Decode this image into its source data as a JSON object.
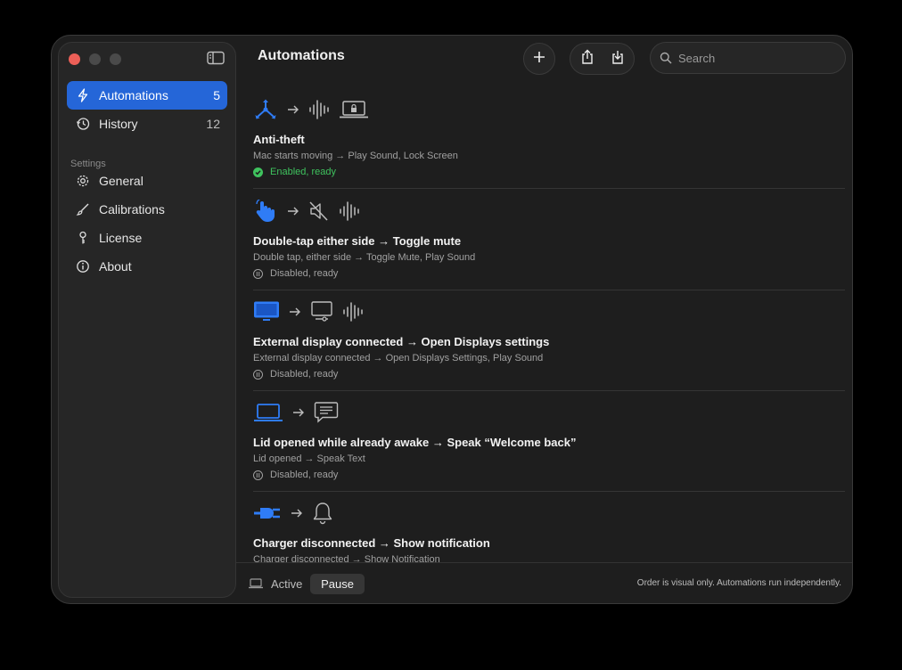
{
  "window": {
    "title": "Automations"
  },
  "sidebar": {
    "items": [
      {
        "label": "Automations",
        "count": "5",
        "icon": "bolt-icon"
      },
      {
        "label": "History",
        "count": "12",
        "icon": "history-icon"
      }
    ],
    "section_label": "Settings",
    "settings": [
      {
        "label": "General",
        "icon": "gear-icon"
      },
      {
        "label": "Calibrations",
        "icon": "brush-icon"
      },
      {
        "label": "License",
        "icon": "key-icon"
      },
      {
        "label": "About",
        "icon": "info-icon"
      }
    ]
  },
  "toolbar": {
    "search_placeholder": "Search"
  },
  "automations": [
    {
      "title": "Anti-theft",
      "desc": "Mac starts moving → Play Sound, Lock Screen",
      "status": "Enabled, ready",
      "enabled": true
    },
    {
      "title": "Double-tap either side → Toggle mute",
      "desc": "Double tap, either side → Toggle Mute, Play Sound",
      "status": "Disabled, ready",
      "enabled": false
    },
    {
      "title": "External display connected → Open Displays settings",
      "desc": "External display connected → Open Displays Settings, Play Sound",
      "status": "Disabled, ready",
      "enabled": false
    },
    {
      "title": "Lid opened while already awake → Speak “Welcome back”",
      "desc": "Lid opened → Speak Text",
      "status": "Disabled, ready",
      "enabled": false
    },
    {
      "title": "Charger disconnected → Show notification",
      "desc": "Charger disconnected → Show Notification",
      "status": "",
      "enabled": false
    }
  ],
  "footer": {
    "state": "Active",
    "pause_label": "Pause",
    "note": "Order is visual only. Automations run independently."
  },
  "colors": {
    "accent": "#2566d8",
    "enabled": "#3fc35e",
    "background": "#1e1e1e"
  }
}
